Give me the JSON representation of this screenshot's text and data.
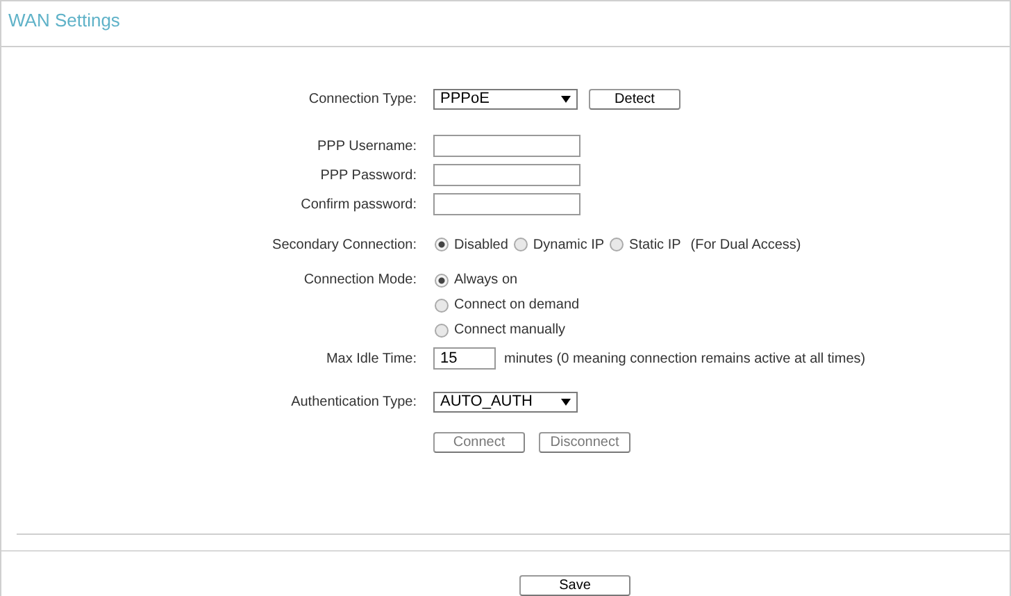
{
  "title": "WAN Settings",
  "connection_type": {
    "label": "Connection Type:",
    "value": "PPPoE",
    "button": "Detect"
  },
  "credentials": [
    {
      "label": "PPP Username:"
    },
    {
      "label": "PPP Password:"
    },
    {
      "label": "Confirm password:"
    }
  ],
  "secondary_connection": {
    "label": "Secondary Connection:",
    "options": [
      {
        "label": "Disabled",
        "selected": true
      },
      {
        "label": "Dynamic IP",
        "selected": false
      },
      {
        "label": "Static IP",
        "selected": false
      }
    ],
    "note": "(For Dual Access)"
  },
  "connection_mode": {
    "label": "Connection Mode:",
    "options": [
      {
        "label": "Always on",
        "selected": true
      },
      {
        "label": "Connect on demand",
        "selected": false
      },
      {
        "label": "Connect manually",
        "selected": false
      }
    ]
  },
  "max_idle_time": {
    "label": "Max Idle Time:",
    "value": "15",
    "note": "minutes (0 meaning connection remains active at all times)"
  },
  "authentication_type": {
    "label": "Authentication Type:",
    "value": "AUTO_AUTH"
  },
  "actions": [
    {
      "label": "Connect",
      "disabled": true
    },
    {
      "label": "Disconnect",
      "disabled": true
    }
  ],
  "save": "Save"
}
